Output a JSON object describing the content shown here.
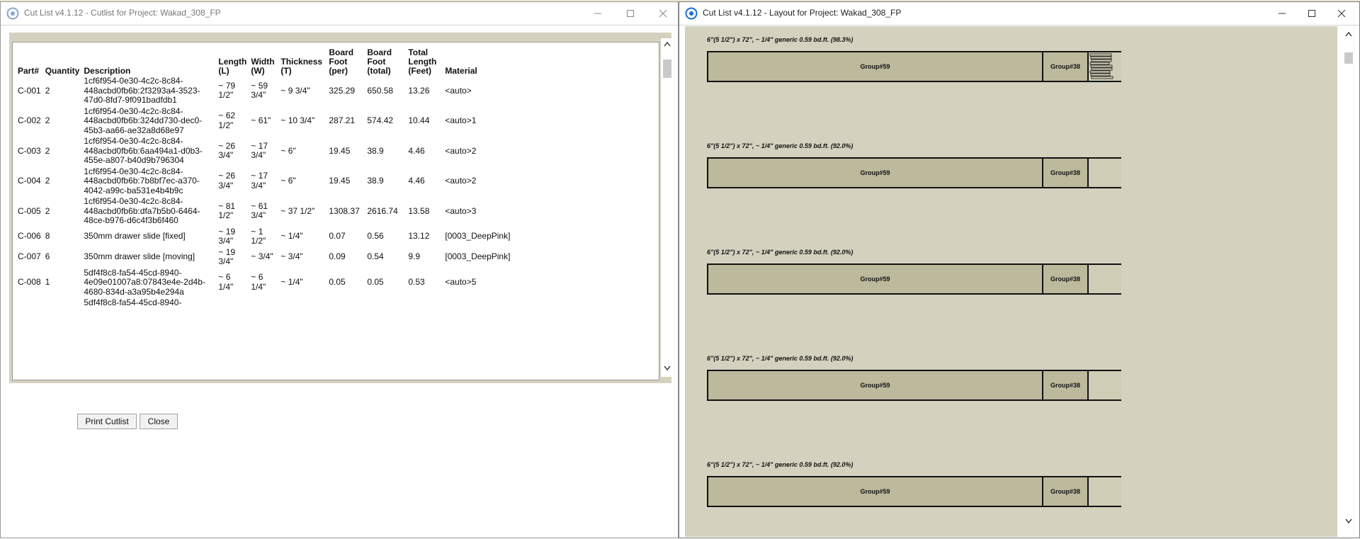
{
  "left_window": {
    "title": "Cut List v4.1.12 - Cutlist for Project: Wakad_308_FP",
    "table": {
      "headers": [
        "Part#",
        "Quantity",
        "Description",
        "Length (L)",
        "Width (W)",
        "Thickness (T)",
        "Board Foot (per)",
        "Board Foot (total)",
        "Total Length (Feet)",
        "Material"
      ],
      "rows": [
        [
          "C-001",
          "2",
          "1cf6f954-0e30-4c2c-8c84-448acbd0fb6b:2f3293a4-3523-47d0-8fd7-9f091badfdb1",
          "~ 79 1/2\"",
          "~ 59 3/4\"",
          "~ 9 3/4\"",
          "325.29",
          "650.58",
          "13.26",
          "<auto>"
        ],
        [
          "C-002",
          "2",
          "1cf6f954-0e30-4c2c-8c84-448acbd0fb6b:324dd730-dec0-45b3-aa66-ae32a8d68e97",
          "~ 62 1/2\"",
          "~ 61\"",
          "~ 10 3/4\"",
          "287.21",
          "574.42",
          "10.44",
          "<auto>1"
        ],
        [
          "C-003",
          "2",
          "1cf6f954-0e30-4c2c-8c84-448acbd0fb6b:6aa494a1-d0b3-455e-a807-b40d9b796304",
          "~ 26 3/4\"",
          "~ 17 3/4\"",
          "~ 6\"",
          "19.45",
          "38.9",
          "4.46",
          "<auto>2"
        ],
        [
          "C-004",
          "2",
          "1cf6f954-0e30-4c2c-8c84-448acbd0fb6b:7b8bf7ec-a370-4042-a99c-ba531e4b4b9c",
          "~ 26 3/4\"",
          "~ 17 3/4\"",
          "~ 6\"",
          "19.45",
          "38.9",
          "4.46",
          "<auto>2"
        ],
        [
          "C-005",
          "2",
          "1cf6f954-0e30-4c2c-8c84-448acbd0fb6b:dfa7b5b0-6464-48ce-b976-d6c4f3b6f460",
          "~ 81 1/2\"",
          "~ 61 3/4\"",
          "~ 37 1/2\"",
          "1308.37",
          "2616.74",
          "13.58",
          "<auto>3"
        ],
        [
          "C-006",
          "8",
          "350mm drawer slide [fixed]",
          "~ 19 3/4\"",
          "~ 1 1/2\"",
          "~ 1/4\"",
          "0.07",
          "0.56",
          "13.12",
          "[0003_DeepPink]"
        ],
        [
          "C-007",
          "6",
          "350mm drawer slide [moving]",
          "~ 19 3/4\"",
          "~ 3/4\"",
          "~ 3/4\"",
          "0.09",
          "0.54",
          "9.9",
          "[0003_DeepPink]"
        ],
        [
          "C-008",
          "1",
          "5df4f8c8-fa54-45cd-8940-4e09e01007a8:07843e4e-2d4b-4680-834d-a3a95b4e294a",
          "~ 6 1/4\"",
          "~ 6 1/4\"",
          "~ 1/4\"",
          "0.05",
          "0.05",
          "0.53",
          "<auto>5"
        ],
        [
          "",
          "",
          "5df4f8c8-fa54-45cd-8940-",
          "",
          "",
          "",
          "",
          "",
          "",
          ""
        ]
      ]
    },
    "buttons": {
      "print": "Print Cutlist",
      "close": "Close"
    }
  },
  "right_window": {
    "title": "Cut List v4.1.12 - Layout for Project: Wakad_308_FP",
    "boards": [
      {
        "label": "6\"(5 1/2\") x 72\", ~ 1/4\" generic 0.59 bd.ft. (98.3%)",
        "parts": [
          "Group#59",
          "Group#38"
        ],
        "small_parts": true
      },
      {
        "label": "6\"(5 1/2\") x 72\", ~ 1/4\" generic 0.59 bd.ft. (92.0%)",
        "parts": [
          "Group#59",
          "Group#38"
        ],
        "small_parts": false
      },
      {
        "label": "6\"(5 1/2\") x 72\", ~ 1/4\" generic 0.59 bd.ft. (92.0%)",
        "parts": [
          "Group#59",
          "Group#38"
        ],
        "small_parts": false
      },
      {
        "label": "6\"(5 1/2\") x 72\", ~ 1/4\" generic 0.59 bd.ft. (92.0%)",
        "parts": [
          "Group#59",
          "Group#38"
        ],
        "small_parts": false
      },
      {
        "label": "6\"(5 1/2\") x 72\", ~ 1/4\" generic 0.59 bd.ft. (92.0%)",
        "parts": [
          "Group#59",
          "Group#38"
        ],
        "small_parts": false
      }
    ]
  },
  "colors": {
    "panel_bg": "#d4d1be",
    "board_fill": "#bcb99d",
    "accent_icon": "#1a6fd1"
  },
  "icons": [
    "sketchup-app-icon",
    "minimize-icon",
    "maximize-icon",
    "close-icon",
    "scroll-up-icon",
    "scroll-down-icon"
  ]
}
